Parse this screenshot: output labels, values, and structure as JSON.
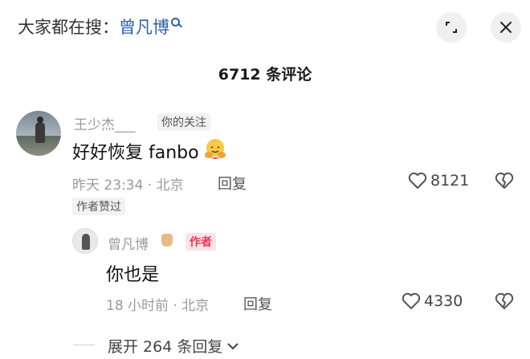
{
  "header": {
    "search_prefix": "大家都在搜：",
    "search_keyword": "曾凡博",
    "search_icon": "magnifier-icon",
    "expand_icon": "expand-corners-icon",
    "close_icon": "close-icon"
  },
  "comments_count_label": "6712 条评论",
  "comments": [
    {
      "username": "王少杰___",
      "badge": "你的关注",
      "text": "好好恢复 fanbo",
      "emoji": "hugging-face-emoji",
      "meta": "昨天 23:34 · 北京",
      "reply_label": "回复",
      "likes": "8121",
      "liked_by_author_badge": "作者赞过"
    }
  ],
  "reply": {
    "username": "曾凡博",
    "badge": "作者",
    "text": "你也是",
    "meta": "18 小时前 · 北京",
    "reply_label": "回复",
    "likes": "4330"
  },
  "expand_replies_label": "展开 264 条回复",
  "colors": {
    "keyword": "#2f5fa8",
    "author_badge_bg": "#fbe3e6",
    "author_badge_text": "#e23b52",
    "muted_text": "#9a9a9a"
  }
}
